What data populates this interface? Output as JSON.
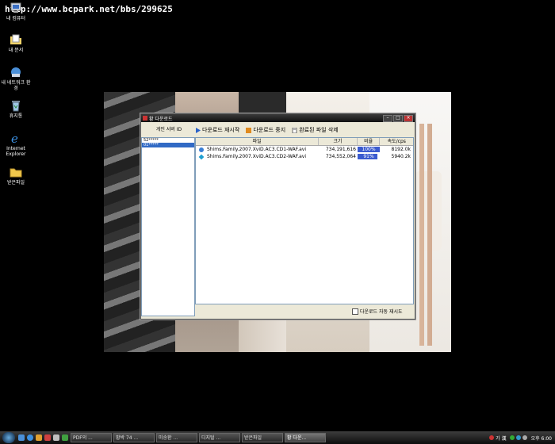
{
  "url_overlay": "http://www.bcpark.net/bbs/299625",
  "desktop": {
    "icons": [
      {
        "label": "내 컴퓨터",
        "icon": "my-computer-icon"
      },
      {
        "label": "내 문서",
        "icon": "my-documents-icon"
      },
      {
        "label": "내 네트워크 환경",
        "icon": "network-icon"
      },
      {
        "label": "휴지통",
        "icon": "recycle-bin-icon"
      },
      {
        "label": "Internet Explorer",
        "icon": "internet-explorer-icon"
      },
      {
        "label": "받은파일",
        "icon": "folder-icon"
      }
    ]
  },
  "window": {
    "title": "황 다운로드",
    "left_header": "게인 서버 ID",
    "servers": [
      {
        "id": "52*****"
      },
      {
        "id": "01*****"
      }
    ],
    "toolbar": {
      "restart": "다운로드 재시작",
      "stop": "다운로드 중지",
      "delete_done": "완료된 파일 삭제"
    },
    "columns": {
      "file": "파일",
      "size": "크기",
      "ratio": "비율",
      "speed": "속도/cps"
    },
    "files": [
      {
        "name": "Shims.Family.2007.XviD.AC3.CD1-WAF.avi",
        "size": "734,191,616",
        "ratio_label": "100%",
        "ratio": 1.0,
        "speed": "8192.0k",
        "icon_color": "#3a7fd5"
      },
      {
        "name": "Shims.Family.2007.XviD.AC3.CD2-WAF.avi",
        "size": "734,552,064",
        "ratio_label": "91%",
        "ratio": 0.91,
        "speed": "5940.2k",
        "icon_color": "#1e9fd0"
      }
    ],
    "auto_resume": "다운로드 자동 재시도"
  },
  "taskbar": {
    "tasks": [
      {
        "label": "PDF의 ..."
      },
      {
        "label": "황박 74 ..."
      },
      {
        "label": "미송환 ..."
      },
      {
        "label": "디지털 ..."
      },
      {
        "label": "받은파일"
      },
      {
        "label": "황 다운..."
      }
    ],
    "ime": "가 漢",
    "clock": "오후 6:00"
  },
  "colors": {
    "progress": "#3b5bcf",
    "selection": "#316ac5",
    "window_bg": "#ece9d8"
  }
}
